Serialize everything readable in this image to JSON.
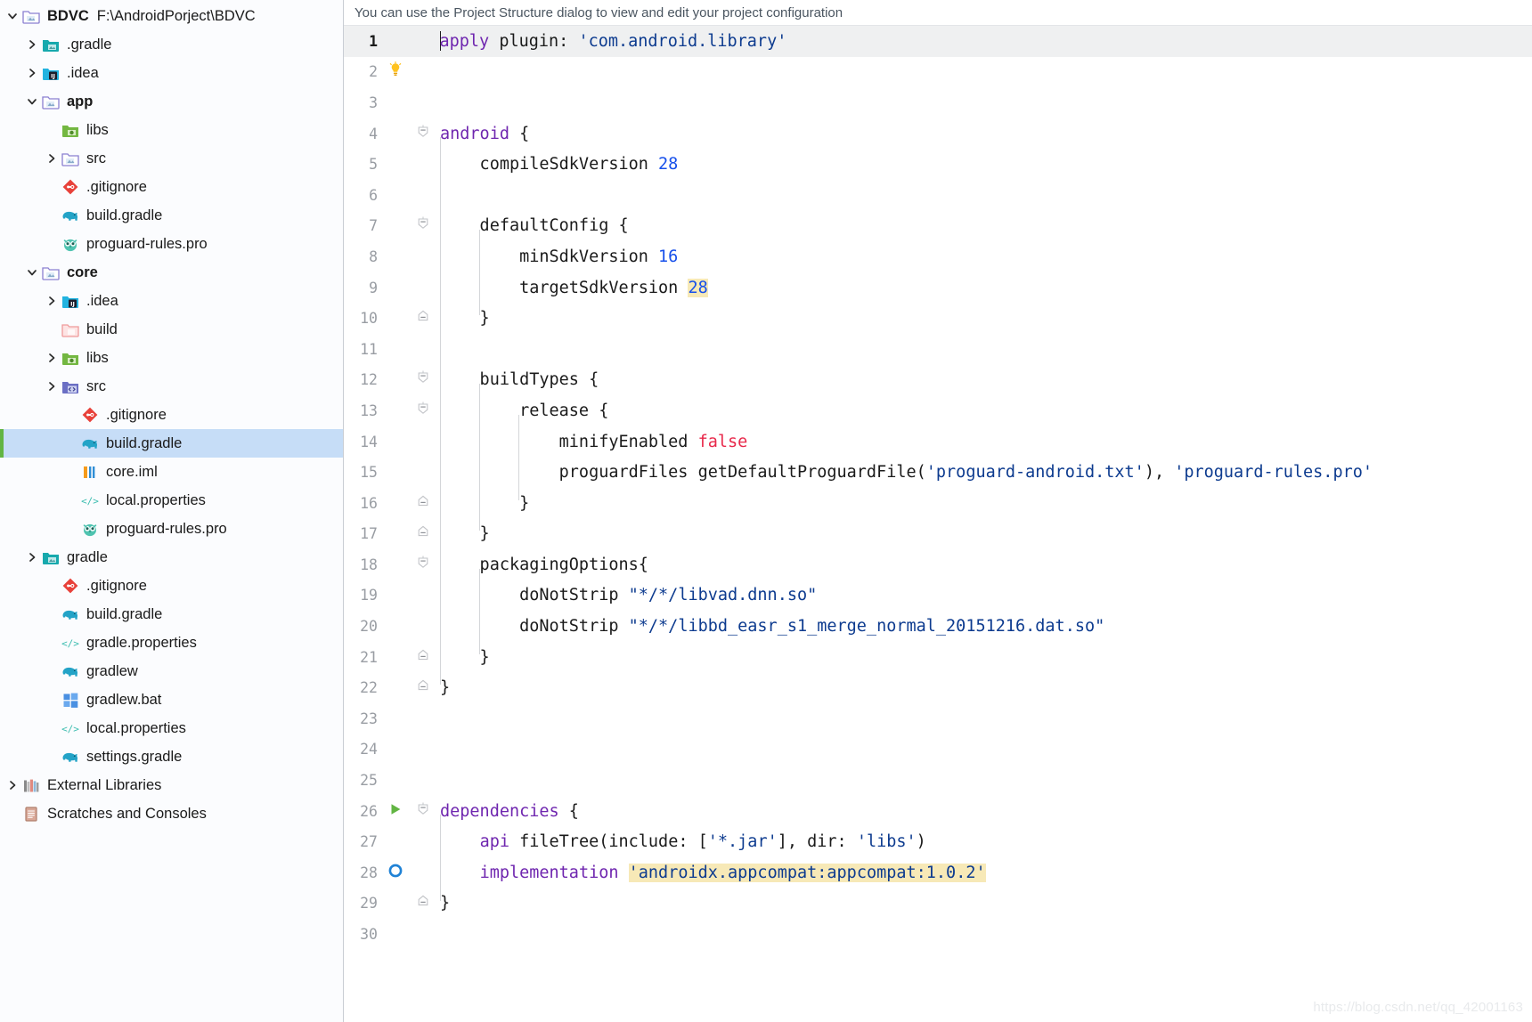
{
  "window": {
    "app": "Android Studio"
  },
  "project_tree": {
    "root": {
      "name": "BDVC",
      "path": "F:\\AndroidPorject\\BDVC",
      "icon": "folder-module-icon",
      "twisty": "chevron-down-icon"
    },
    "items": [
      {
        "label": ".gradle",
        "indent": 1,
        "twisty": "chevron-right-icon",
        "icon": "folder-gradle-icon",
        "bold": false,
        "selected": false
      },
      {
        "label": ".idea",
        "indent": 1,
        "twisty": "chevron-right-icon",
        "icon": "folder-idea-icon",
        "bold": false,
        "selected": false
      },
      {
        "label": "app",
        "indent": 1,
        "twisty": "chevron-down-icon",
        "icon": "folder-module-icon",
        "bold": true,
        "selected": false
      },
      {
        "label": "libs",
        "indent": 2,
        "twisty": "none",
        "icon": "folder-libs-icon",
        "bold": false,
        "selected": false
      },
      {
        "label": "src",
        "indent": 2,
        "twisty": "chevron-right-icon",
        "icon": "folder-module-icon",
        "bold": false,
        "selected": false
      },
      {
        "label": ".gitignore",
        "indent": 2,
        "twisty": "none",
        "icon": "git-icon",
        "bold": false,
        "selected": false
      },
      {
        "label": "build.gradle",
        "indent": 2,
        "twisty": "none",
        "icon": "gradle-elephant-icon",
        "bold": false,
        "selected": false
      },
      {
        "label": "proguard-rules.pro",
        "indent": 2,
        "twisty": "none",
        "icon": "proguard-owl-icon",
        "bold": false,
        "selected": false
      },
      {
        "label": "core",
        "indent": 1,
        "twisty": "chevron-down-icon",
        "icon": "folder-module-icon",
        "bold": true,
        "selected": false
      },
      {
        "label": ".idea",
        "indent": 2,
        "twisty": "chevron-right-icon",
        "icon": "folder-idea-icon",
        "bold": false,
        "selected": false
      },
      {
        "label": "build",
        "indent": 2,
        "twisty": "none",
        "icon": "folder-build-icon",
        "bold": false,
        "selected": false
      },
      {
        "label": "libs",
        "indent": 2,
        "twisty": "chevron-right-icon",
        "icon": "folder-libs-icon",
        "bold": false,
        "selected": false
      },
      {
        "label": "src",
        "indent": 2,
        "twisty": "chevron-right-icon",
        "icon": "folder-source-icon",
        "bold": false,
        "selected": false
      },
      {
        "label": ".gitignore",
        "indent": 3,
        "twisty": "none",
        "icon": "git-icon",
        "bold": false,
        "selected": false
      },
      {
        "label": "build.gradle",
        "indent": 3,
        "twisty": "none",
        "icon": "gradle-elephant-icon",
        "bold": false,
        "selected": true
      },
      {
        "label": "core.iml",
        "indent": 3,
        "twisty": "none",
        "icon": "iml-module-icon",
        "bold": false,
        "selected": false
      },
      {
        "label": "local.properties",
        "indent": 3,
        "twisty": "none",
        "icon": "properties-icon",
        "bold": false,
        "selected": false
      },
      {
        "label": "proguard-rules.pro",
        "indent": 3,
        "twisty": "none",
        "icon": "proguard-owl-icon",
        "bold": false,
        "selected": false
      },
      {
        "label": "gradle",
        "indent": 1,
        "twisty": "chevron-right-icon",
        "icon": "folder-gradle-icon",
        "bold": false,
        "selected": false
      },
      {
        "label": ".gitignore",
        "indent": 2,
        "twisty": "none",
        "icon": "git-icon",
        "bold": false,
        "selected": false
      },
      {
        "label": "build.gradle",
        "indent": 2,
        "twisty": "none",
        "icon": "gradle-elephant-icon",
        "bold": false,
        "selected": false
      },
      {
        "label": "gradle.properties",
        "indent": 2,
        "twisty": "none",
        "icon": "properties-icon",
        "bold": false,
        "selected": false
      },
      {
        "label": "gradlew",
        "indent": 2,
        "twisty": "none",
        "icon": "gradle-elephant-icon",
        "bold": false,
        "selected": false
      },
      {
        "label": "gradlew.bat",
        "indent": 2,
        "twisty": "none",
        "icon": "windows-bat-icon",
        "bold": false,
        "selected": false
      },
      {
        "label": "local.properties",
        "indent": 2,
        "twisty": "none",
        "icon": "properties-icon",
        "bold": false,
        "selected": false
      },
      {
        "label": "settings.gradle",
        "indent": 2,
        "twisty": "none",
        "icon": "gradle-elephant-icon",
        "bold": false,
        "selected": false
      },
      {
        "label": "External Libraries",
        "indent": 0,
        "twisty": "chevron-right-icon",
        "icon": "libraries-books-icon",
        "bold": false,
        "selected": false
      },
      {
        "label": "Scratches and Consoles",
        "indent": 0,
        "twisty": "none",
        "icon": "scratches-icon",
        "bold": false,
        "selected": false
      }
    ]
  },
  "notification": {
    "text": "You can use the Project Structure dialog to view and edit your project configuration"
  },
  "editor": {
    "filename": "build.gradle",
    "current_line": 1,
    "colors": {
      "keyword": "#6f26af",
      "string": "#0d3b8f",
      "number": "#1750eb",
      "boolean": "#e8294b",
      "highlight": "#f7e9b7",
      "current_line_bg": "#eff0f1",
      "selection": "#c6ddf7",
      "run_marker": "#62b543"
    },
    "lines": [
      {
        "n": 1,
        "fold": "none",
        "mark": "caret-marker",
        "tokens": [
          {
            "t": "apply",
            "c": "kw"
          },
          {
            "t": " plugin",
            "c": "plain"
          },
          {
            "t": ": ",
            "c": "plain"
          },
          {
            "t": "'com.android.library'",
            "c": "str"
          }
        ]
      },
      {
        "n": 2,
        "fold": "none",
        "mark": "intention-bulb-icon",
        "tokens": []
      },
      {
        "n": 3,
        "fold": "none",
        "mark": "none",
        "tokens": []
      },
      {
        "n": 4,
        "fold": "open",
        "mark": "none",
        "tokens": [
          {
            "t": "android",
            "c": "kw"
          },
          {
            "t": " {",
            "c": "plain"
          }
        ]
      },
      {
        "n": 5,
        "fold": "none",
        "mark": "none",
        "tokens": [
          {
            "t": "    compileSdkVersion ",
            "c": "plain"
          },
          {
            "t": "28",
            "c": "num"
          }
        ]
      },
      {
        "n": 6,
        "fold": "none",
        "mark": "none",
        "tokens": []
      },
      {
        "n": 7,
        "fold": "open",
        "mark": "none",
        "tokens": [
          {
            "t": "    defaultConfig {",
            "c": "plain"
          }
        ]
      },
      {
        "n": 8,
        "fold": "none",
        "mark": "none",
        "tokens": [
          {
            "t": "        minSdkVersion ",
            "c": "plain"
          },
          {
            "t": "16",
            "c": "num"
          }
        ]
      },
      {
        "n": 9,
        "fold": "none",
        "mark": "none",
        "tokens": [
          {
            "t": "        targetSdkVersion ",
            "c": "plain"
          },
          {
            "t": "28",
            "c": "num hl"
          }
        ]
      },
      {
        "n": 10,
        "fold": "close",
        "mark": "none",
        "tokens": [
          {
            "t": "    }",
            "c": "plain"
          }
        ]
      },
      {
        "n": 11,
        "fold": "none",
        "mark": "none",
        "tokens": []
      },
      {
        "n": 12,
        "fold": "open",
        "mark": "none",
        "tokens": [
          {
            "t": "    buildTypes {",
            "c": "plain"
          }
        ]
      },
      {
        "n": 13,
        "fold": "open",
        "mark": "none",
        "tokens": [
          {
            "t": "        release {",
            "c": "plain"
          }
        ]
      },
      {
        "n": 14,
        "fold": "none",
        "mark": "none",
        "tokens": [
          {
            "t": "            minifyEnabled ",
            "c": "plain"
          },
          {
            "t": "false",
            "c": "bool"
          }
        ]
      },
      {
        "n": 15,
        "fold": "none",
        "mark": "none",
        "tokens": [
          {
            "t": "            proguardFiles getDefaultProguardFile(",
            "c": "plain"
          },
          {
            "t": "'proguard-android.txt'",
            "c": "str"
          },
          {
            "t": "), ",
            "c": "plain"
          },
          {
            "t": "'proguard-rules.pro'",
            "c": "str"
          }
        ]
      },
      {
        "n": 16,
        "fold": "close",
        "mark": "none",
        "tokens": [
          {
            "t": "        }",
            "c": "plain"
          }
        ]
      },
      {
        "n": 17,
        "fold": "close",
        "mark": "none",
        "tokens": [
          {
            "t": "    }",
            "c": "plain"
          }
        ]
      },
      {
        "n": 18,
        "fold": "open",
        "mark": "none",
        "tokens": [
          {
            "t": "    packagingOptions{",
            "c": "plain"
          }
        ]
      },
      {
        "n": 19,
        "fold": "none",
        "mark": "none",
        "tokens": [
          {
            "t": "        doNotStrip ",
            "c": "plain"
          },
          {
            "t": "\"*/*/libvad.dnn.so\"",
            "c": "str"
          }
        ]
      },
      {
        "n": 20,
        "fold": "none",
        "mark": "none",
        "tokens": [
          {
            "t": "        doNotStrip ",
            "c": "plain"
          },
          {
            "t": "\"*/*/libbd_easr_s1_merge_normal_20151216.dat.so\"",
            "c": "str"
          }
        ]
      },
      {
        "n": 21,
        "fold": "close",
        "mark": "none",
        "tokens": [
          {
            "t": "    }",
            "c": "plain"
          }
        ]
      },
      {
        "n": 22,
        "fold": "close",
        "mark": "none",
        "tokens": [
          {
            "t": "}",
            "c": "plain"
          }
        ]
      },
      {
        "n": 23,
        "fold": "none",
        "mark": "none",
        "tokens": []
      },
      {
        "n": 24,
        "fold": "none",
        "mark": "none",
        "tokens": []
      },
      {
        "n": 25,
        "fold": "none",
        "mark": "none",
        "tokens": []
      },
      {
        "n": 26,
        "fold": "open",
        "mark": "run-gradle-task-icon",
        "tokens": [
          {
            "t": "dependencies",
            "c": "kw"
          },
          {
            "t": " {",
            "c": "plain"
          }
        ]
      },
      {
        "n": 27,
        "fold": "none",
        "mark": "none",
        "tokens": [
          {
            "t": "    ",
            "c": "plain"
          },
          {
            "t": "api",
            "c": "kw"
          },
          {
            "t": " fileTree(include: [",
            "c": "plain"
          },
          {
            "t": "'*.jar'",
            "c": "str"
          },
          {
            "t": "], dir: ",
            "c": "plain"
          },
          {
            "t": "'libs'",
            "c": "str"
          },
          {
            "t": ")",
            "c": "plain"
          }
        ]
      },
      {
        "n": 28,
        "fold": "none",
        "mark": "dependency-circle-icon",
        "tokens": [
          {
            "t": "    ",
            "c": "plain"
          },
          {
            "t": "implementation",
            "c": "kw"
          },
          {
            "t": " ",
            "c": "plain"
          },
          {
            "t": "'androidx.appcompat:appcompat:1.0.2'",
            "c": "str hl"
          }
        ]
      },
      {
        "n": 29,
        "fold": "close",
        "mark": "none",
        "tokens": [
          {
            "t": "}",
            "c": "plain"
          }
        ]
      },
      {
        "n": 30,
        "fold": "none",
        "mark": "none",
        "tokens": []
      }
    ]
  },
  "watermark": {
    "text": "https://blog.csdn.net/qq_42001163"
  }
}
